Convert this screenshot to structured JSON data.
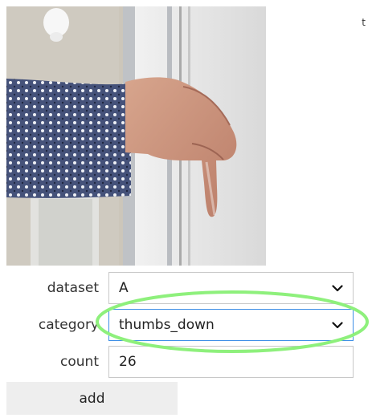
{
  "corner_mark": "t",
  "form": {
    "dataset": {
      "label": "dataset",
      "value": "A"
    },
    "category": {
      "label": "category",
      "value": "thumbs_down"
    },
    "count": {
      "label": "count",
      "value": "26"
    },
    "add_button": "add"
  },
  "colors": {
    "focus_border": "#3d8fe6",
    "highlight_ring": "#8ef07c",
    "button_bg": "#eeeeee"
  },
  "icons": {
    "select_arrow": "chevron-down-icon"
  }
}
